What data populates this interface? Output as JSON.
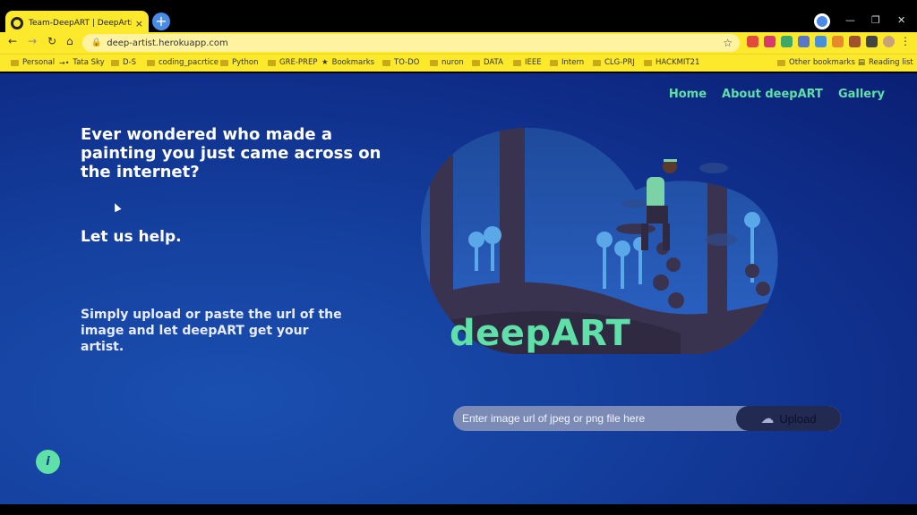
{
  "browser": {
    "tab_title": "Team-DeepART | DeepArtist : Fin",
    "tab_close": "×",
    "new_tab": "+",
    "url": "deep-artist.herokuapp.com",
    "bookmarks": [
      "Personal",
      "Tata Sky",
      "D-S",
      "coding_pacrtice",
      "Python",
      "GRE-PREP",
      "Bookmarks",
      "TO-DO",
      "nuron",
      "DATA",
      "IEEE",
      "Intern",
      "CLG-PRJ",
      "HACKMIT21"
    ],
    "other_bookmarks": "Other bookmarks",
    "reading_list": "Reading list"
  },
  "nav": {
    "home": "Home",
    "about": "About deepART",
    "gallery": "Gallery"
  },
  "hero": {
    "headline": "Ever wondered who made a painting you just came across on the internet?",
    "subhead": "Let us help.",
    "paragraph": "Simply upload or paste the url of the image and let deepART get your artist."
  },
  "brand": "deepART",
  "search": {
    "placeholder": "Enter image url of jpeg or png file here",
    "upload_label": "Upload"
  },
  "info_button": "i",
  "colors": {
    "accent": "#5ee0a8",
    "chrome_theme": "#fde92b",
    "page_bg": "#1541a0"
  }
}
